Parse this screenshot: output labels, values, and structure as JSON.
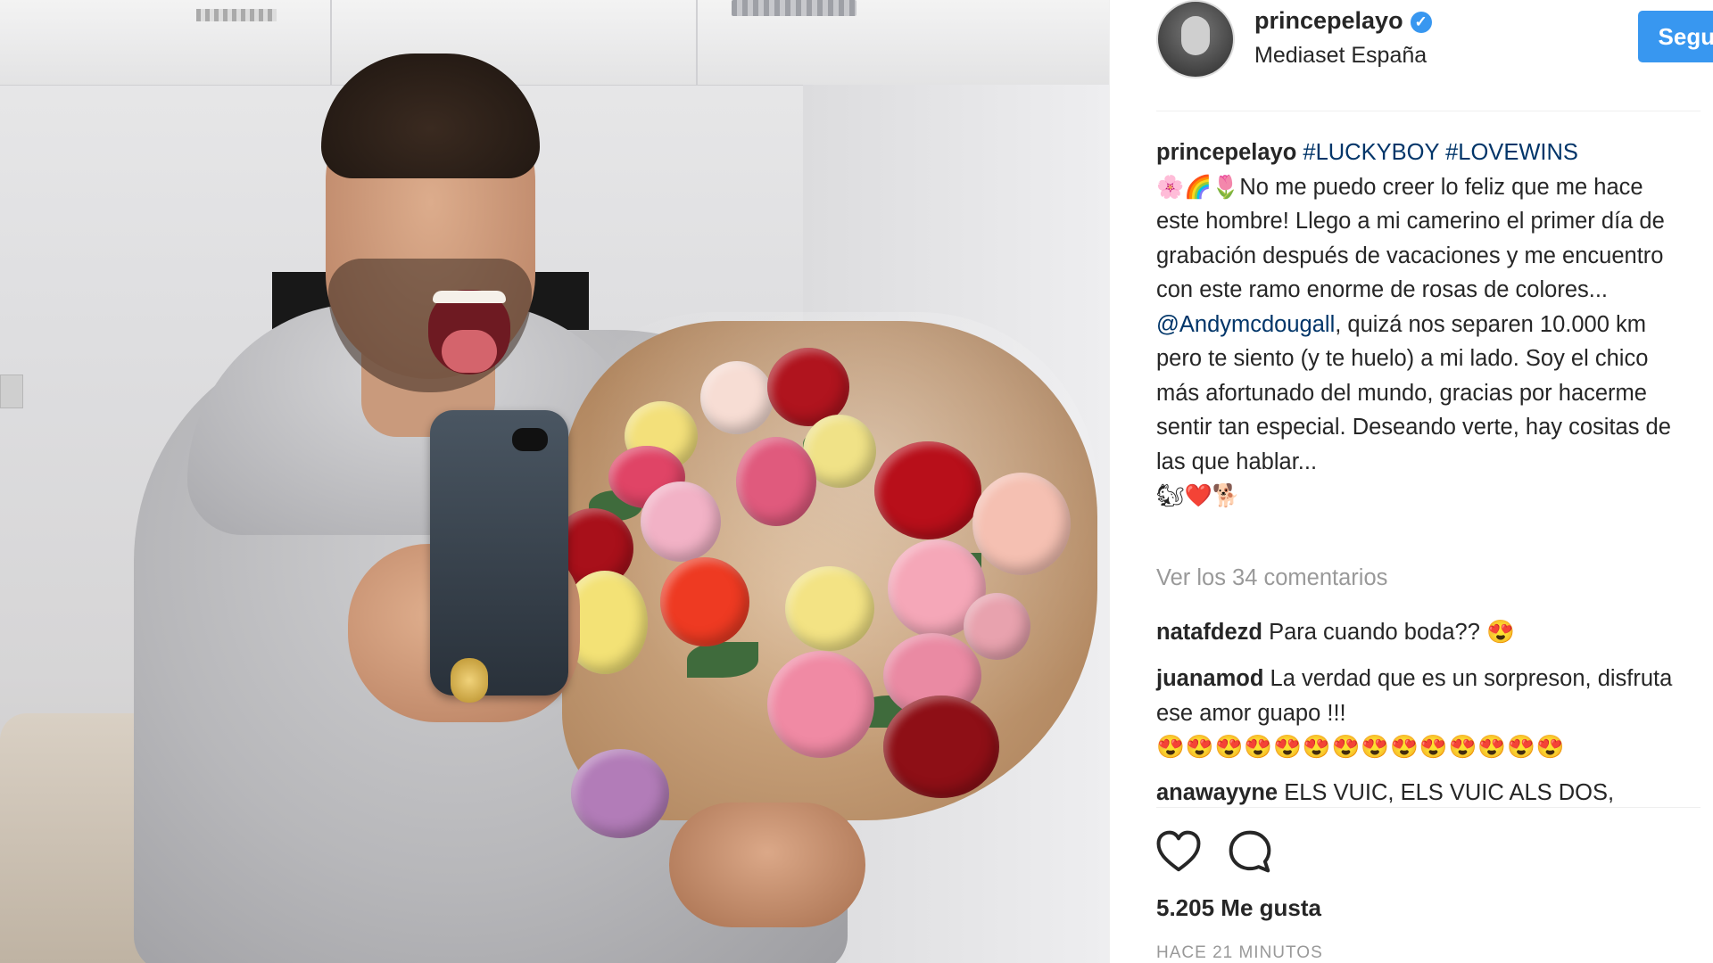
{
  "post": {
    "username": "princepelayo",
    "verified_icon": "verified-badge-icon",
    "location": "Mediaset España",
    "follow_label": "Seguir",
    "caption": {
      "username": "princepelayo",
      "hashtag1": "#LUCKYBOY",
      "hashtag2": "#LOVEWINS",
      "lead_emojis": "🌸🌈🌷",
      "text1": "No me puedo creer lo feliz que me hace este hombre! Llego a mi camerino el primer día de grabación después de vacaciones y me encuentro con este ramo enorme de rosas de colores...",
      "mention": "@Andymcdougall",
      "text2": ", quizá nos separen 10.000 km pero te siento (y te huelo) a mi lado. Soy el chico más afortunado del mundo, gracias por hacerme sentir tan especial. Deseando verte, hay cositas de las que hablar...",
      "trail_emojis": "🐿❤️🐕"
    },
    "view_all_comments": "Ver los 34 comentarios",
    "comments": [
      {
        "user": "natafdezd",
        "text": "Para cuando boda?? 😍"
      },
      {
        "user": "juanamod",
        "text": "La verdad que es un sorpreson, disfruta ese amor guapo !!!",
        "emojis": "😍😍😍😍😍😍😍😍😍😍😍😍😍😍"
      },
      {
        "user": "anawayyne",
        "text": "ELS VUIC, ELS VUIC ALS DOS,"
      }
    ],
    "likes": "5.205 Me gusta",
    "time": "HACE 21 MINUTOS",
    "icons": {
      "like": "heart-outline-icon",
      "comment": "speech-bubble-icon"
    },
    "colors": {
      "accent": "#3897f0",
      "tag": "#003569",
      "muted": "#999999"
    }
  }
}
